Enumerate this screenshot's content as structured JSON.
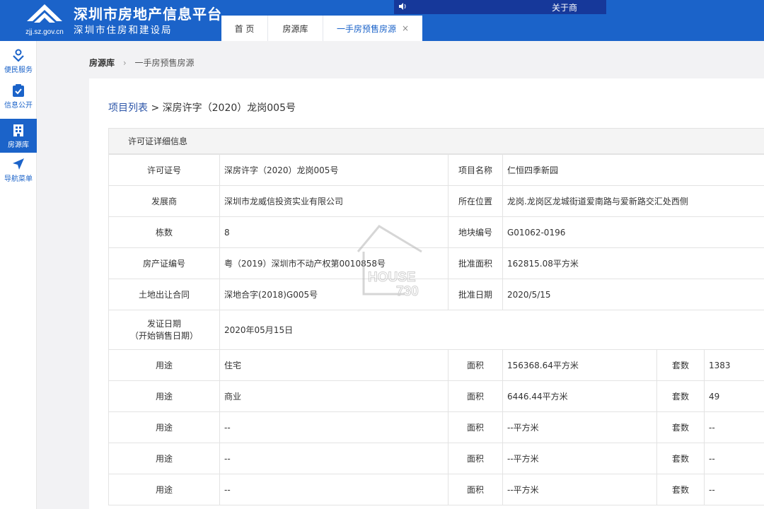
{
  "header": {
    "site_title": "深圳市房地产信息平台",
    "site_subtitle": "深圳市住房和建设局",
    "logo_url_text": "zjj.sz.gov.cn",
    "about_link": "关于商",
    "tabs": [
      {
        "label": "首 页"
      },
      {
        "label": "房源库"
      },
      {
        "label": "一手房预售房源",
        "close": "×"
      }
    ]
  },
  "sidebar": {
    "items": [
      {
        "label": "便民服务",
        "icon": "service-icon"
      },
      {
        "label": "信息公开",
        "icon": "clipboard-check-icon"
      },
      {
        "label": "房源库",
        "icon": "building-icon"
      },
      {
        "label": "导航菜单",
        "icon": "navigation-icon"
      }
    ]
  },
  "breadcrumb": {
    "root": "房源库",
    "current": "一手房预售房源"
  },
  "project_crumb": {
    "link": "项目列表",
    "separator": " > ",
    "current": "深房许字（2020）龙岗005号"
  },
  "detail": {
    "section_title": "许可证详细信息",
    "rows": [
      {
        "l1": "许可证号",
        "v1": "深房许字（2020）龙岗005号",
        "l2": "项目名称",
        "v2": "仁恒四季新园"
      },
      {
        "l1": "发展商",
        "v1": "深圳市龙威信投资实业有限公司",
        "l2": "所在位置",
        "v2": "龙岗.龙岗区龙城街道爱南路与爱新路交汇处西侧"
      },
      {
        "l1": "栋数",
        "v1": "8",
        "l2": "地块编号",
        "v2": "G01062-0196"
      },
      {
        "l1": "房产证编号",
        "v1": "粤（2019）深圳市不动产权第0010858号",
        "l2": "批准面积",
        "v2": "162815.08平方米"
      },
      {
        "l1": "土地出让合同",
        "v1": "深地合字(2018)G005号",
        "l2": "批准日期",
        "v2": "2020/5/15"
      }
    ],
    "issue": {
      "label_line1": "发证日期",
      "label_line2": "（开始销售日期）",
      "value": "2020年05月15日"
    },
    "usage_rows": [
      {
        "use_label": "用途",
        "use": "住宅",
        "area_label": "面积",
        "area": "156368.64平方米",
        "units_label": "套数",
        "units": "1383"
      },
      {
        "use_label": "用途",
        "use": "商业",
        "area_label": "面积",
        "area": "6446.44平方米",
        "units_label": "套数",
        "units": "49"
      },
      {
        "use_label": "用途",
        "use": "--",
        "area_label": "面积",
        "area": "--平方米",
        "units_label": "套数",
        "units": "--"
      },
      {
        "use_label": "用途",
        "use": "--",
        "area_label": "面积",
        "area": "--平方米",
        "units_label": "套数",
        "units": "--"
      },
      {
        "use_label": "用途",
        "use": "--",
        "area_label": "面积",
        "area": "--平方米",
        "units_label": "套数",
        "units": "--"
      }
    ]
  },
  "watermark": {
    "line1": "HOUSE",
    "line2": "730"
  },
  "colors": {
    "brand_blue": "#1b63c9",
    "marquee_blue": "#16389a",
    "link_blue": "#2c55a8"
  }
}
